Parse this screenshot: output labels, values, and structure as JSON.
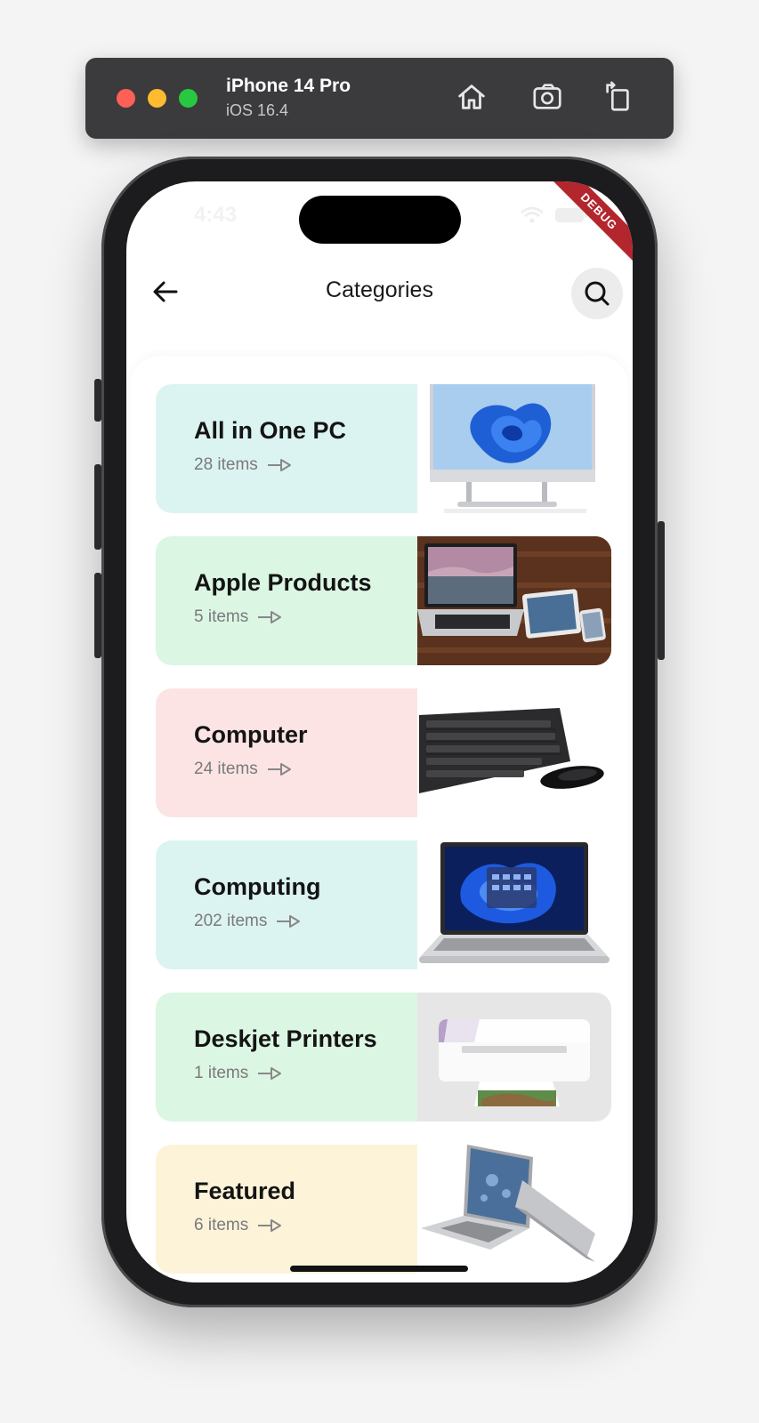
{
  "simulator": {
    "device_name": "iPhone 14 Pro",
    "os_version": "iOS 16.4",
    "tools": [
      "home-icon",
      "screenshot-icon",
      "rotate-icon"
    ]
  },
  "status_bar": {
    "time": "4:43",
    "debug_banner": "DEBUG"
  },
  "header": {
    "title": "Categories",
    "back_icon": "arrow-left-icon",
    "search_icon": "search-icon"
  },
  "categories": [
    {
      "name": "All in One PC",
      "count": "28 items",
      "bg": "#dcf4f1",
      "image": "all-in-one-pc"
    },
    {
      "name": "Apple Products",
      "count": "5 items",
      "bg": "#dcf6e4",
      "image": "apple-products"
    },
    {
      "name": "Computer",
      "count": "24 items",
      "bg": "#fde4e4",
      "image": "keyboard-mouse"
    },
    {
      "name": "Computing",
      "count": "202 items",
      "bg": "#dcf4f1",
      "image": "laptop"
    },
    {
      "name": "Deskjet Printers",
      "count": "1 items",
      "bg": "#dcf6e4",
      "image": "printer"
    },
    {
      "name": "Featured",
      "count": "6 items",
      "bg": "#fcf3d9",
      "image": "silver-laptop"
    }
  ]
}
